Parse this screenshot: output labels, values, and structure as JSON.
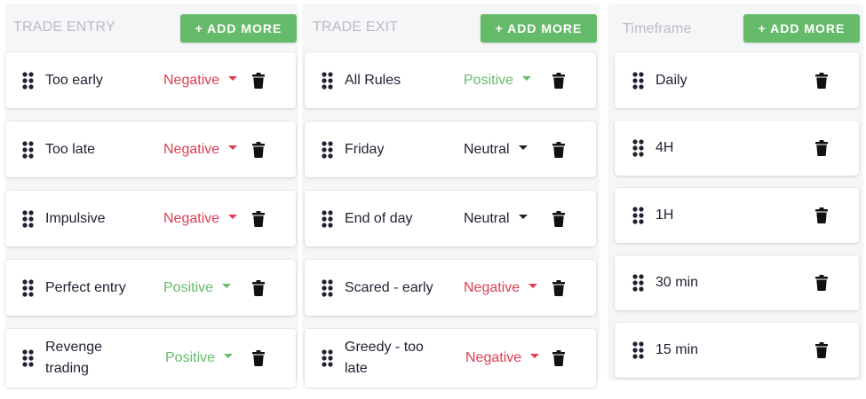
{
  "colors": {
    "negative": "#e03c53",
    "positive": "#66bb6a",
    "neutral": "#1f2130",
    "button": "#66bb6a"
  },
  "columns": [
    {
      "title": "TRADE ENTRY",
      "add_label": "+ ADD MORE",
      "items": [
        {
          "label": "Too early",
          "sentiment": "Negative"
        },
        {
          "label": "Too late",
          "sentiment": "Negative"
        },
        {
          "label": "Impulsive",
          "sentiment": "Negative"
        },
        {
          "label": "Perfect entry",
          "sentiment": "Positive"
        },
        {
          "label": "Revenge trading",
          "sentiment": "Positive"
        }
      ]
    },
    {
      "title": "TRADE EXIT",
      "add_label": "+ ADD MORE",
      "items": [
        {
          "label": "All Rules",
          "sentiment": "Positive"
        },
        {
          "label": "Friday",
          "sentiment": "Neutral"
        },
        {
          "label": "End of day",
          "sentiment": "Neutral"
        },
        {
          "label": "Scared - early",
          "sentiment": "Negative"
        },
        {
          "label": "Greedy - too late",
          "sentiment": "Negative"
        }
      ]
    },
    {
      "title": "Timeframe",
      "add_label": "+ ADD MORE",
      "items": [
        {
          "label": "Daily"
        },
        {
          "label": "4H"
        },
        {
          "label": "1H"
        },
        {
          "label": "30 min"
        },
        {
          "label": "15 min"
        }
      ]
    }
  ]
}
